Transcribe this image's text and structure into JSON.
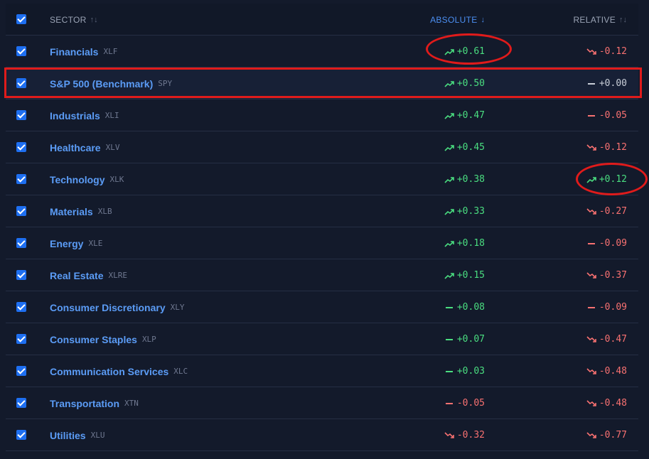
{
  "header": {
    "sector_label": "SECTOR",
    "absolute_label": "ABSOLUTE",
    "relative_label": "RELATIVE",
    "sort_neutral_glyph": "↑↓",
    "sort_desc_glyph": "↓"
  },
  "colors": {
    "accent": "#4c8ff2",
    "positive": "#4ade80",
    "negative": "#f87171",
    "neutral": "#c9ced8",
    "annotation": "#e01b1b"
  },
  "rows": [
    {
      "name": "Financials",
      "ticker": "XLF",
      "abs": "+0.61",
      "abs_trend": "up",
      "rel": "-0.12",
      "rel_trend": "down"
    },
    {
      "name": "S&P 500 (Benchmark)",
      "ticker": "SPY",
      "abs": "+0.50",
      "abs_trend": "up",
      "rel": "+0.00",
      "rel_trend": "flat-zero"
    },
    {
      "name": "Industrials",
      "ticker": "XLI",
      "abs": "+0.47",
      "abs_trend": "up",
      "rel": "-0.05",
      "rel_trend": "flat-neg"
    },
    {
      "name": "Healthcare",
      "ticker": "XLV",
      "abs": "+0.45",
      "abs_trend": "up",
      "rel": "-0.12",
      "rel_trend": "down"
    },
    {
      "name": "Technology",
      "ticker": "XLK",
      "abs": "+0.38",
      "abs_trend": "up",
      "rel": "+0.12",
      "rel_trend": "up"
    },
    {
      "name": "Materials",
      "ticker": "XLB",
      "abs": "+0.33",
      "abs_trend": "up",
      "rel": "-0.27",
      "rel_trend": "down"
    },
    {
      "name": "Energy",
      "ticker": "XLE",
      "abs": "+0.18",
      "abs_trend": "up",
      "rel": "-0.09",
      "rel_trend": "flat-neg"
    },
    {
      "name": "Real Estate",
      "ticker": "XLRE",
      "abs": "+0.15",
      "abs_trend": "up",
      "rel": "-0.37",
      "rel_trend": "down"
    },
    {
      "name": "Consumer Discretionary",
      "ticker": "XLY",
      "abs": "+0.08",
      "abs_trend": "flat-pos",
      "rel": "-0.09",
      "rel_trend": "flat-neg"
    },
    {
      "name": "Consumer Staples",
      "ticker": "XLP",
      "abs": "+0.07",
      "abs_trend": "flat-pos",
      "rel": "-0.47",
      "rel_trend": "down"
    },
    {
      "name": "Communication Services",
      "ticker": "XLC",
      "abs": "+0.03",
      "abs_trend": "flat-pos",
      "rel": "-0.48",
      "rel_trend": "down"
    },
    {
      "name": "Transportation",
      "ticker": "XTN",
      "abs": "-0.05",
      "abs_trend": "flat-neg",
      "rel": "-0.48",
      "rel_trend": "down"
    },
    {
      "name": "Utilities",
      "ticker": "XLU",
      "abs": "-0.32",
      "abs_trend": "down",
      "rel": "-0.77",
      "rel_trend": "down"
    }
  ]
}
